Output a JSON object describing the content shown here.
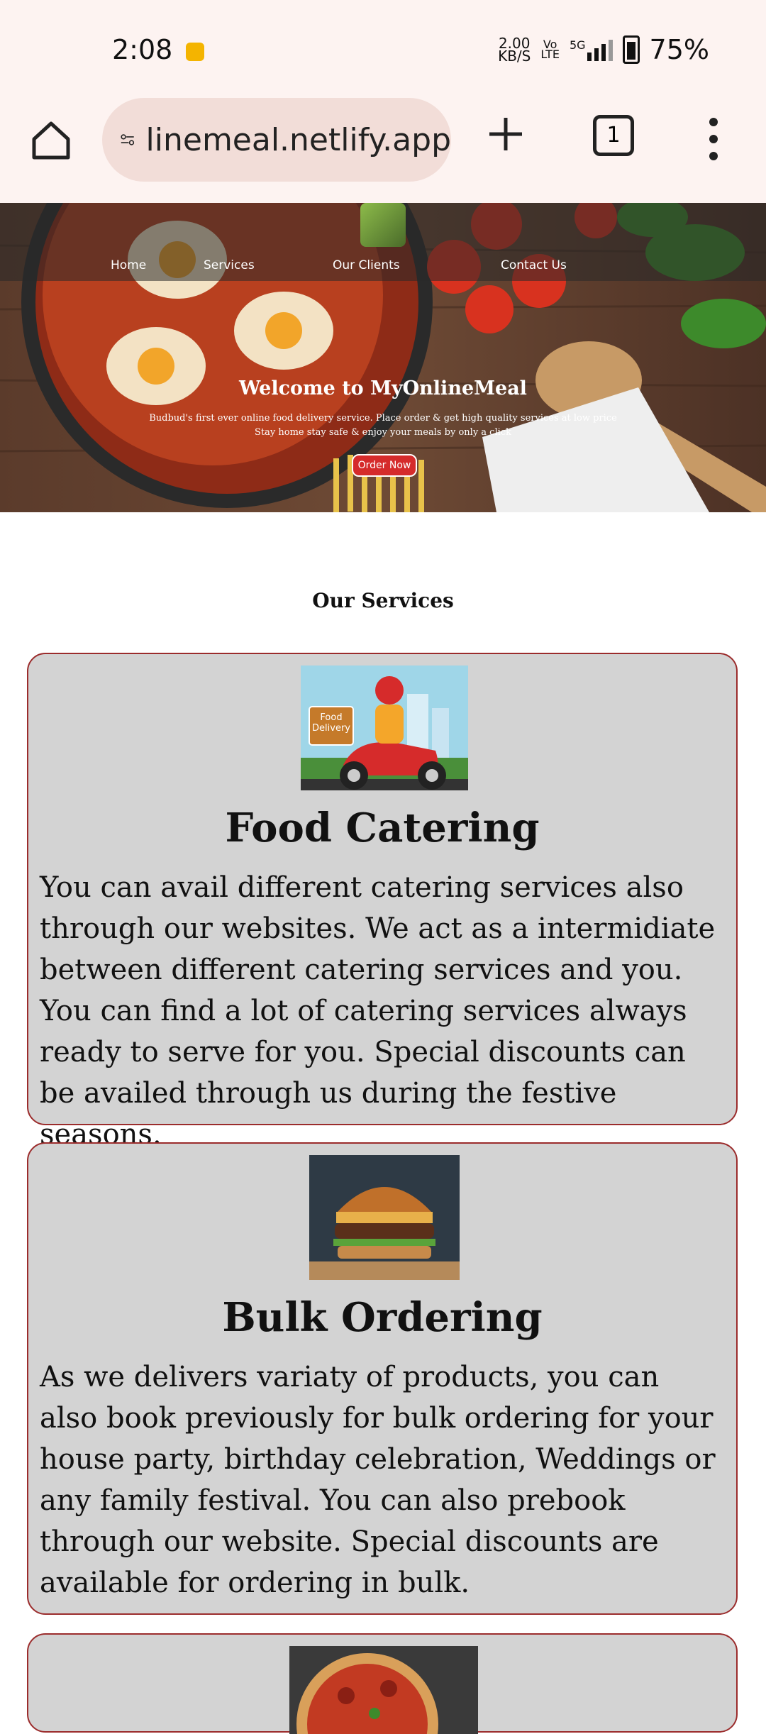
{
  "status": {
    "time": "2:08",
    "net_speed": "2.00",
    "net_unit": "KB/S",
    "volte_top": "Vo",
    "volte_bottom": "LTE",
    "signal": "5G",
    "battery": "75%"
  },
  "browser": {
    "url": "linemeal.netlify.app",
    "tab_count": "1"
  },
  "nav": {
    "items": [
      "Home",
      "Services",
      "Our Clients",
      "Contact Us"
    ]
  },
  "hero": {
    "title": "Welcome to MyOnlineMeal",
    "subtitle_1": "Budbud's first ever online food delivery service. Place order & get high quality services at low price",
    "subtitle_2": "Stay home stay safe & enjoy your meals by only a click",
    "cta": "Order Now"
  },
  "services": {
    "title": "Our Services",
    "cards": [
      {
        "title": "Food Catering",
        "image_label_1": "Food",
        "image_label_2": "Delivery",
        "text": "You can avail different catering services also through our websites. We act as a intermidiate between different catering services and you. You can find a lot of catering services always ready to serve for you. Special discounts can be availed through us during the festive seasons."
      },
      {
        "title": "Bulk Ordering",
        "text": "As we delivers variaty of products, you can also book previously for bulk ordering for your house party, birthday celebration, Weddings or any family festival. You can also prebook through our website. Special discounts are available for ordering in bulk."
      }
    ]
  }
}
